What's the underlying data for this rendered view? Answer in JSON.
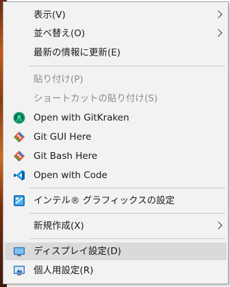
{
  "menu": {
    "items": [
      {
        "label": "表示(V)"
      },
      {
        "label": "並べ替え(O)"
      },
      {
        "label": "最新の情報に更新(E)"
      },
      {
        "label": "貼り付け(P)"
      },
      {
        "label": "ショートカットの貼り付け(S)"
      },
      {
        "label": "Open with GitKraken"
      },
      {
        "label": "Git GUI Here"
      },
      {
        "label": "Git Bash Here"
      },
      {
        "label": "Open with Code"
      },
      {
        "label": "インテル® グラフィックスの設定"
      },
      {
        "label": "新規作成(X)"
      },
      {
        "label": "ディスプレイ設定(D)"
      },
      {
        "label": "個人用設定(R)"
      }
    ]
  },
  "colors": {
    "menu_background": "#f2f2f2",
    "hover_background": "#dadada",
    "disabled_text": "#8c8c8c",
    "git_orange": "#f05133",
    "vscode_blue": "#0065a9",
    "gitkraken_green": "#17936c"
  },
  "icons": {
    "gitkraken": "gitkraken-icon",
    "git_gui": "git-icon",
    "git_bash": "git-icon",
    "vscode": "vscode-icon",
    "intel_graphics": "intel-graphics-icon",
    "display_settings": "monitor-icon",
    "personalize": "personalize-icon"
  }
}
